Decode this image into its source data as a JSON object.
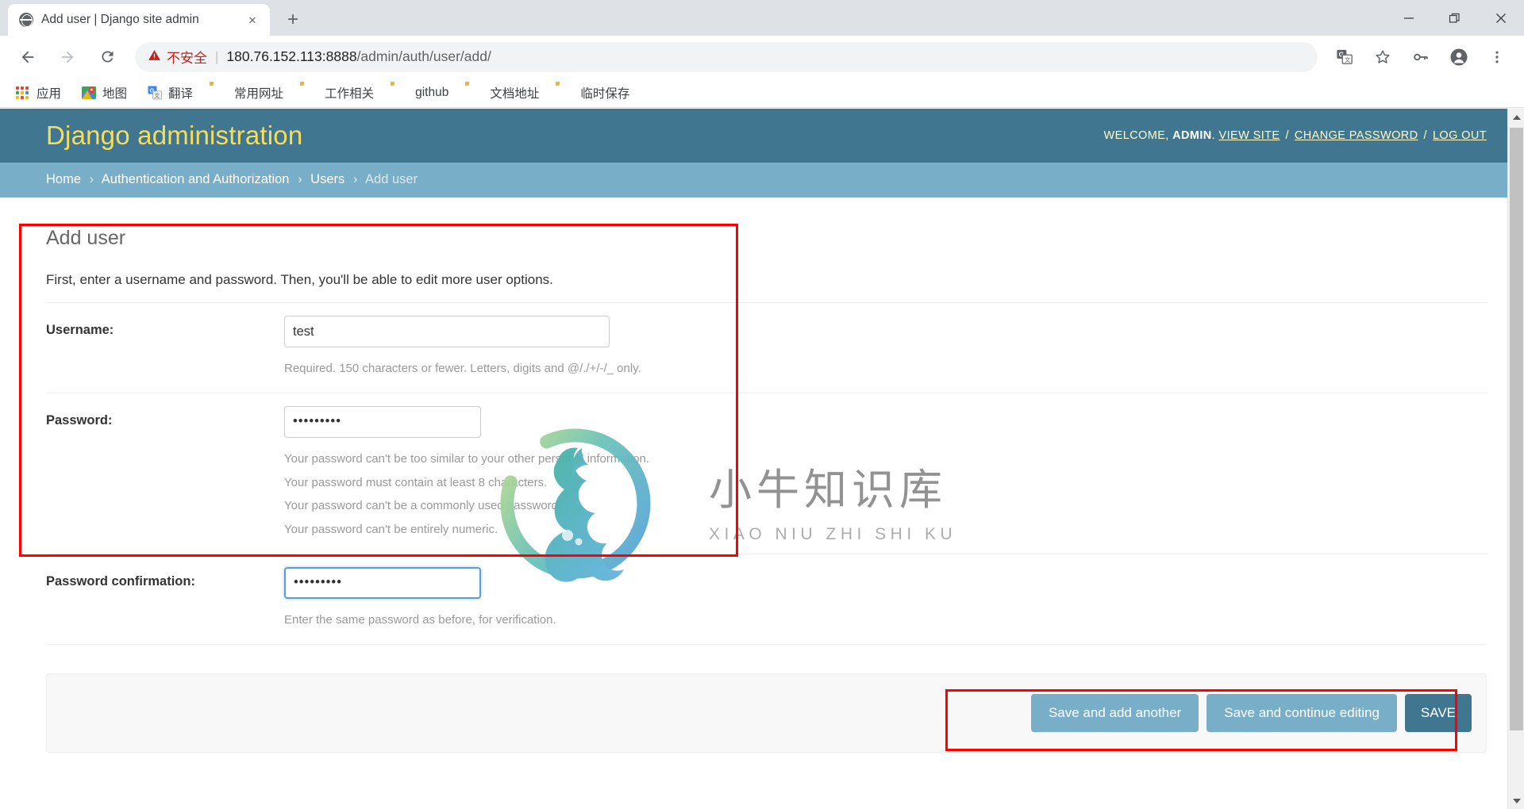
{
  "browser": {
    "tab": {
      "title": "Add user | Django site admin",
      "favicon": "globe-icon",
      "close": "×"
    },
    "new_tab_label": "+",
    "window_controls": {
      "minimize": "minimize-icon",
      "maximize": "maximize-icon",
      "close": "close-icon"
    },
    "nav": {
      "back": "←",
      "forward": "→",
      "reload": "↻"
    },
    "omnibox": {
      "security_icon": "warning-triangle-icon",
      "security_text": "不安全",
      "separator": "|",
      "url_host": "180.76.152.113:8888",
      "url_path": "/admin/auth/user/add/",
      "url_full": "180.76.152.113:8888/admin/auth/user/add/"
    },
    "toolbar_icons": [
      {
        "name": "translate-icon"
      },
      {
        "name": "bookmark-star-icon"
      },
      {
        "name": "password-key-icon"
      },
      {
        "name": "profile-avatar-icon"
      },
      {
        "name": "chrome-menu-icon"
      }
    ],
    "bookmarks": [
      {
        "label": "应用",
        "icon": "apps-grid-icon"
      },
      {
        "label": "地图",
        "icon": "google-maps-icon"
      },
      {
        "label": "翻译",
        "icon": "google-translate-icon"
      },
      {
        "label": "常用网址",
        "icon": "folder-icon"
      },
      {
        "label": "工作相关",
        "icon": "folder-icon"
      },
      {
        "label": "github",
        "icon": "folder-icon"
      },
      {
        "label": "文档地址",
        "icon": "folder-icon"
      },
      {
        "label": "临时保存",
        "icon": "folder-icon"
      }
    ]
  },
  "site": {
    "branding": "Django administration",
    "header_bg": "#417690",
    "breadcrumb_bg": "#79aec8",
    "brand_color": "#f5dd5d",
    "user_tools": {
      "welcome": "WELCOME,",
      "username": "ADMIN",
      "period": ".",
      "view_site": "VIEW SITE",
      "change_password": "CHANGE PASSWORD",
      "log_out": "LOG OUT",
      "sep": "/"
    },
    "breadcrumbs": [
      {
        "label": "Home",
        "link": true
      },
      {
        "label": "Authentication and Authorization",
        "link": true
      },
      {
        "label": "Users",
        "link": true
      },
      {
        "label": "Add user",
        "link": false
      }
    ],
    "breadcrumb_sep": "›"
  },
  "main": {
    "title": "Add user",
    "intro": "First, enter a username and password. Then, you'll be able to edit more user options.",
    "fields": [
      {
        "label": "Username:",
        "value": "test",
        "type": "text",
        "help": [
          "Required. 150 characters or fewer. Letters, digits and @/./+/-/_ only."
        ],
        "focused": false
      },
      {
        "label": "Password:",
        "value": "•••••••••",
        "type": "password",
        "help": [
          "Your password can't be too similar to your other personal information.",
          "Your password must contain at least 8 characters.",
          "Your password can't be a commonly used password.",
          "Your password can't be entirely numeric."
        ],
        "focused": false
      },
      {
        "label": "Password confirmation:",
        "value": "•••••••••",
        "type": "password",
        "help": [
          "Enter the same password as before, for verification."
        ],
        "focused": true
      }
    ],
    "buttons": {
      "save_and_add_another": "Save and add another",
      "save_and_continue": "Save and continue editing",
      "save": "SAVE",
      "button_color": "#79aec8",
      "default_button_color": "#417690"
    }
  },
  "watermark": {
    "logo": "bull-circle-logo",
    "text_cn": "小牛知识库",
    "text_en": "XIAO NIU ZHI SHI KU"
  },
  "annotations": {
    "color": "#ff0000",
    "boxes": [
      {
        "name": "form-area-highlight"
      },
      {
        "name": "submit-buttons-highlight"
      }
    ]
  }
}
